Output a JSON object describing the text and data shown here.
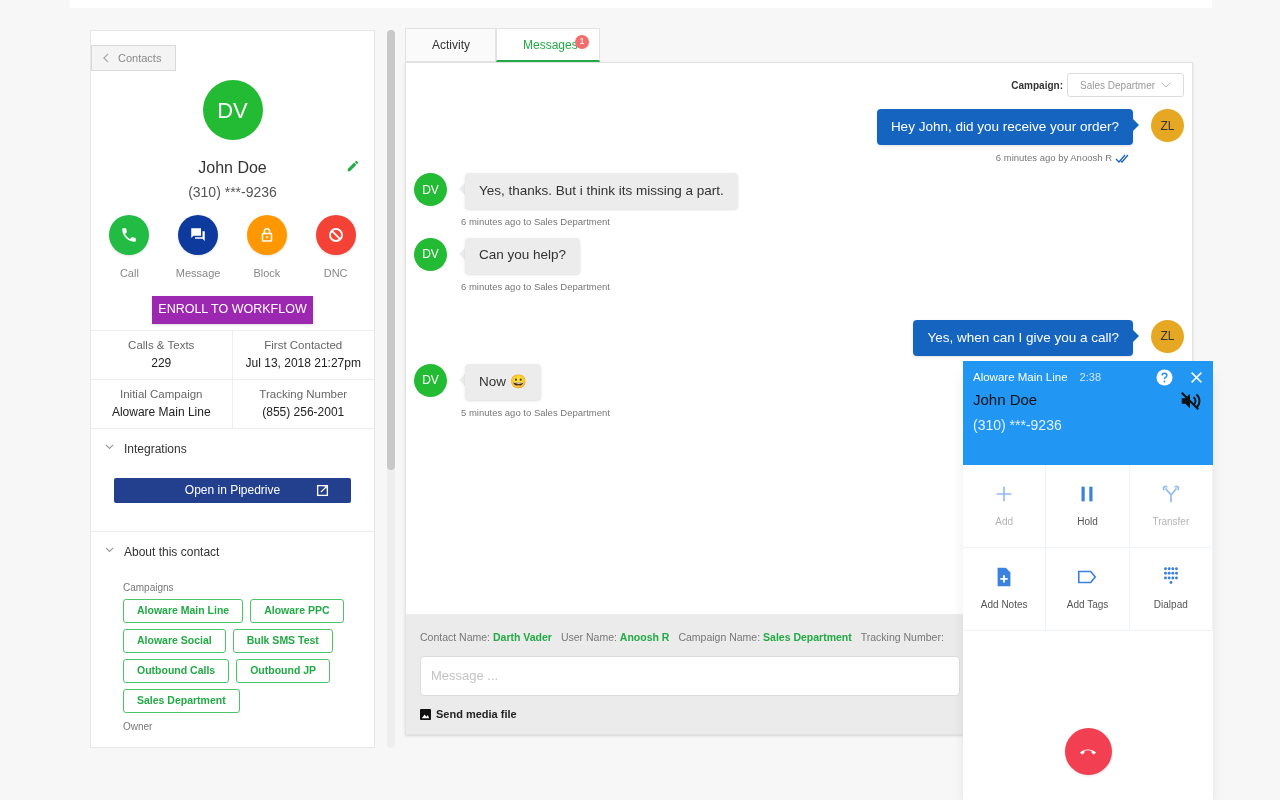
{
  "contact_panel": {
    "back_button": "Contacts",
    "avatar": "DV",
    "name": "John Doe",
    "phone": "(310) ***-9236",
    "actions": [
      {
        "kind": "call",
        "label": "Call",
        "color": "#22bb44"
      },
      {
        "kind": "message",
        "label": "Message",
        "color": "#0d3a9c"
      },
      {
        "kind": "block",
        "label": "Block",
        "color": "#ff9800"
      },
      {
        "kind": "dnc",
        "label": "DNC",
        "color": "#f44336"
      }
    ],
    "enroll_button": "ENROLL TO WORKFLOW",
    "stats": [
      {
        "label": "Calls & Texts",
        "value": "229"
      },
      {
        "label": "First Contacted",
        "value": "Jul 13, 2018 21:27pm"
      },
      {
        "label": "Initial Campaign",
        "value": "Aloware Main Line"
      },
      {
        "label": "Tracking Number",
        "value": "(855) 256-2001"
      }
    ],
    "integrations": {
      "title": "Integrations",
      "expanded": true,
      "button": "Open in Pipedrive"
    },
    "about": {
      "title": "About this contact",
      "expanded": true,
      "campaigns_label": "Campaigns",
      "campaigns": [
        "Aloware Main Line",
        "Aloware PPC",
        "Aloware Social",
        "Bulk SMS Test",
        "Outbound Calls",
        "Outbound JP",
        "Sales Department"
      ],
      "owner_label": "Owner"
    }
  },
  "tabs": [
    {
      "label": "Activity",
      "selected": false
    },
    {
      "label": "Messages",
      "selected": true,
      "badge": "1"
    }
  ],
  "campaign_filter": {
    "label": "Campaign:",
    "value": "Sales Departmer"
  },
  "messages": [
    {
      "kind": "sent",
      "avatar": "ZL",
      "text": "Hey John, did you receive your order?",
      "meta": "6 minutes ago by Anoosh R",
      "read": true
    },
    {
      "kind": "received",
      "avatar": "DV",
      "text": "Yes, thanks. But i think its missing a part.",
      "meta": "6 minutes ago to Sales Department"
    },
    {
      "kind": "received",
      "avatar": "DV",
      "text": "Can you help?",
      "meta": "6 minutes ago to Sales Department"
    },
    {
      "kind": "sent",
      "avatar": "ZL",
      "text": "Yes, when can I give you a call?"
    },
    {
      "kind": "received",
      "avatar": "DV",
      "text": "Now 😀",
      "meta": "5 minutes ago to Sales Department"
    }
  ],
  "composer": {
    "info": [
      {
        "label": "Contact Name:",
        "value": "Darth Vader"
      },
      {
        "label": "User Name:",
        "value": "Anoosh R"
      },
      {
        "label": "Campaign Name:",
        "value": "Sales Department"
      },
      {
        "label": "Tracking Number:"
      }
    ],
    "placeholder": "Message ...",
    "media_button": "Send media file"
  },
  "call_widget": {
    "line": "Aloware Main Line",
    "timer": "2:38",
    "name": "John Doe",
    "phone": "(310) ***-9236",
    "muted": true,
    "actions": [
      {
        "kind": "add",
        "label": "Add",
        "disabled": true
      },
      {
        "kind": "hold",
        "label": "Hold",
        "disabled": false
      },
      {
        "kind": "transfer",
        "label": "Transfer",
        "disabled": true
      },
      {
        "kind": "notes",
        "label": "Add Notes",
        "disabled": false
      },
      {
        "kind": "tags",
        "label": "Add Tags",
        "disabled": false
      },
      {
        "kind": "dialpad",
        "label": "Dialpad",
        "disabled": false
      }
    ]
  }
}
